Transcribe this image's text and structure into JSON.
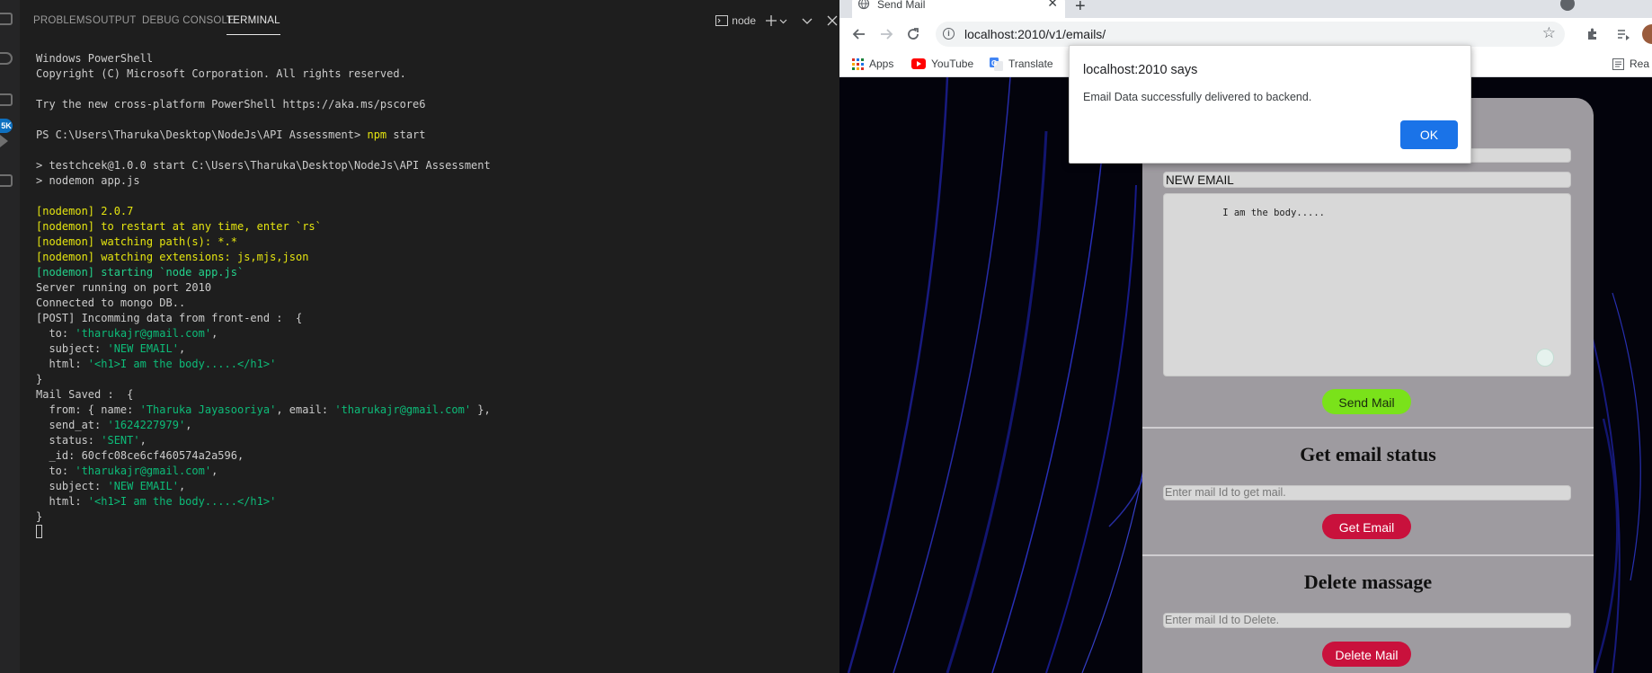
{
  "vscode": {
    "tabs": [
      {
        "label": "PROBLEMS",
        "active": false
      },
      {
        "label": "OUTPUT",
        "active": false
      },
      {
        "label": "DEBUG CONSOLE",
        "active": false
      },
      {
        "label": "TERMINAL",
        "active": true
      }
    ],
    "terminal_profile": "node",
    "activity_badge": "5K",
    "colors": {
      "panel_bg": "#1e1e1e",
      "text": "#cccccc",
      "yellow": "#e5e510",
      "green": "#23d18b",
      "string": "#0dbc79"
    },
    "terminal_lines": [
      {
        "text": "Windows PowerShell",
        "color": "default"
      },
      {
        "text": "Copyright (C) Microsoft Corporation. All rights reserved.",
        "color": "default"
      },
      {
        "text": "",
        "color": "default"
      },
      {
        "text": "Try the new cross-platform PowerShell https://aka.ms/pscore6",
        "color": "default"
      },
      {
        "text": "",
        "color": "default"
      },
      {
        "segments": [
          {
            "text": "PS C:\\Users\\Tharuka\\Desktop\\NodeJs\\API Assessment> ",
            "color": "default"
          },
          {
            "text": "npm",
            "color": "yellow"
          },
          {
            "text": " start",
            "color": "default"
          }
        ]
      },
      {
        "text": "",
        "color": "default"
      },
      {
        "text": "> testchcek@1.0.0 start C:\\Users\\Tharuka\\Desktop\\NodeJs\\API Assessment",
        "color": "default"
      },
      {
        "text": "> nodemon app.js",
        "color": "default"
      },
      {
        "text": "",
        "color": "default"
      },
      {
        "text": "[nodemon] 2.0.7",
        "color": "yellow"
      },
      {
        "text": "[nodemon] to restart at any time, enter `rs`",
        "color": "yellow"
      },
      {
        "text": "[nodemon] watching path(s): *.*",
        "color": "yellow"
      },
      {
        "text": "[nodemon] watching extensions: js,mjs,json",
        "color": "yellow"
      },
      {
        "text": "[nodemon] starting `node app.js`",
        "color": "green"
      },
      {
        "text": "Server running on port 2010",
        "color": "default"
      },
      {
        "text": "Connected to mongo DB..",
        "color": "default"
      },
      {
        "text": "[POST] Incomming data from front-end :  {",
        "color": "default"
      },
      {
        "segments": [
          {
            "text": "  to: ",
            "color": "default"
          },
          {
            "text": "'tharukajr@gmail.com'",
            "color": "string"
          },
          {
            "text": ",",
            "color": "default"
          }
        ]
      },
      {
        "segments": [
          {
            "text": "  subject: ",
            "color": "default"
          },
          {
            "text": "'NEW EMAIL'",
            "color": "string"
          },
          {
            "text": ",",
            "color": "default"
          }
        ]
      },
      {
        "segments": [
          {
            "text": "  html: ",
            "color": "default"
          },
          {
            "text": "'<h1>I am the body.....</h1>'",
            "color": "string"
          }
        ]
      },
      {
        "text": "}",
        "color": "default"
      },
      {
        "text": "Mail Saved :  {",
        "color": "default"
      },
      {
        "segments": [
          {
            "text": "  from: { name: ",
            "color": "default"
          },
          {
            "text": "'Tharuka Jayasooriya'",
            "color": "string"
          },
          {
            "text": ", email: ",
            "color": "default"
          },
          {
            "text": "'tharukajr@gmail.com'",
            "color": "string"
          },
          {
            "text": " },",
            "color": "default"
          }
        ]
      },
      {
        "segments": [
          {
            "text": "  send_at: ",
            "color": "default"
          },
          {
            "text": "'1624227979'",
            "color": "string"
          },
          {
            "text": ",",
            "color": "default"
          }
        ]
      },
      {
        "segments": [
          {
            "text": "  status: ",
            "color": "default"
          },
          {
            "text": "'SENT'",
            "color": "string"
          },
          {
            "text": ",",
            "color": "default"
          }
        ]
      },
      {
        "text": "  _id: 60cfc08ce6cf460574a2a596,",
        "color": "default"
      },
      {
        "segments": [
          {
            "text": "  to: ",
            "color": "default"
          },
          {
            "text": "'tharukajr@gmail.com'",
            "color": "string"
          },
          {
            "text": ",",
            "color": "default"
          }
        ]
      },
      {
        "segments": [
          {
            "text": "  subject: ",
            "color": "default"
          },
          {
            "text": "'NEW EMAIL'",
            "color": "string"
          },
          {
            "text": ",",
            "color": "default"
          }
        ]
      },
      {
        "segments": [
          {
            "text": "  html: ",
            "color": "default"
          },
          {
            "text": "'<h1>I am the body.....</h1>'",
            "color": "string"
          }
        ]
      },
      {
        "text": "}",
        "color": "default"
      }
    ]
  },
  "browser": {
    "tab_title": "Send Mail",
    "url": "localhost:2010/v1/emails/",
    "bookmarks": [
      {
        "label": "Apps",
        "icon": "apps-grid-icon"
      },
      {
        "label": "YouTube",
        "icon": "youtube-icon"
      },
      {
        "label": "Translate",
        "icon": "translate-icon"
      }
    ],
    "reading_list_label": "Rea",
    "page": {
      "subject_value": "NEW EMAIL",
      "body_value": "I am the body.....",
      "send_button": "Send Mail",
      "status_title": "Get email status",
      "get_placeholder": "Enter mail Id to get mail.",
      "get_button": "Get Email",
      "delete_title": "Delete massage",
      "delete_placeholder": "Enter mail Id to Delete.",
      "delete_button": "Delete Mail",
      "colors": {
        "send_button": "#7ae21a",
        "danger_button": "#c9113c",
        "card": "#9e9ba0"
      }
    },
    "dialog": {
      "title": "localhost:2010 says",
      "message": "Email Data successfully delivered to backend.",
      "ok_label": "OK",
      "ok_color": "#1a73e8"
    }
  }
}
